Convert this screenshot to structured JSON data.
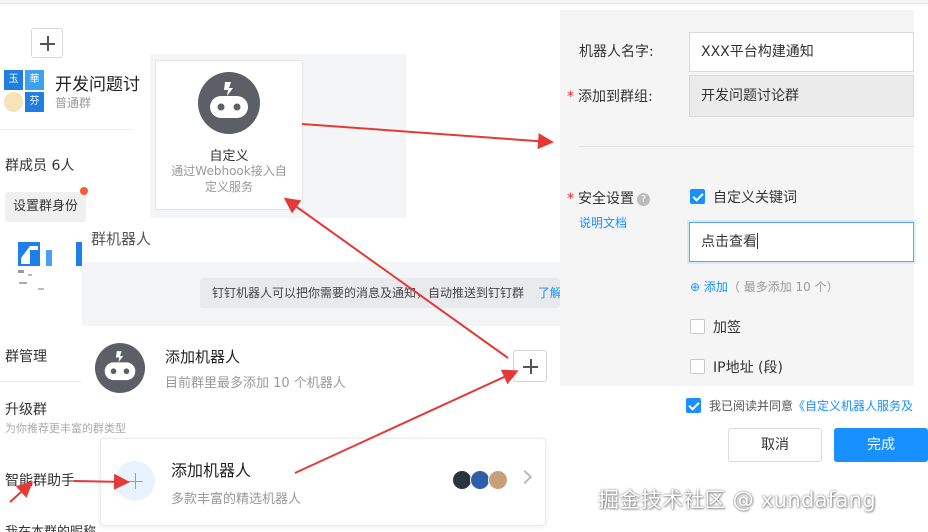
{
  "group": {
    "avatar_chars": [
      "玉",
      "華",
      "芬",
      ""
    ],
    "name": "开发问题讨",
    "type": "普通群",
    "members": "群成员 6人",
    "set_role": "设置群身份"
  },
  "custom_bot_card": {
    "title": "自定义",
    "desc": "通过Webhook接入自定义服务"
  },
  "group_bots_label": "群机器人",
  "notice": {
    "text": "钉钉机器人可以把你需要的消息及通知，自动推送到钉钉群",
    "link": "了解"
  },
  "add_bot_row": {
    "title": "添加机器人",
    "sub": "目前群里最多添加 10 个机器人"
  },
  "left_menu": {
    "manage": "群管理",
    "upgrade": "升级群",
    "upgrade_hint": "为你推荐更丰富的群类型",
    "assistant": "智能群助手",
    "nickname": "我在本群的昵称"
  },
  "bottom_card": {
    "title": "添加机器人",
    "sub": "多款丰富的精选机器人",
    "icon_colors": [
      "#2b3440",
      "#2f5fa8",
      "#c9a07a"
    ]
  },
  "form": {
    "name_label": "机器人名字:",
    "name_value": "XXX平台构建通知",
    "group_label": "添加到群组:",
    "group_value": "开发问题讨论群",
    "security_label": "安全设置",
    "help_icon": "?",
    "doc_link": "说明文档",
    "keyword_option": "自定义关键词",
    "keyword_value": "点击查看",
    "add_link": "添加",
    "add_hint": "（ 最多添加 10 个）",
    "sign_option": "加签",
    "ip_option": "IP地址 (段)",
    "agree_prefix": "我已阅读并同意",
    "agree_link": "《自定义机器人服务及",
    "cancel": "取消",
    "done": "完成"
  },
  "watermark": "掘金技术社区 @ xundafang",
  "colors": {
    "accent": "#1890ff",
    "arrow": "#e53935",
    "robot": "#5c5f66"
  }
}
